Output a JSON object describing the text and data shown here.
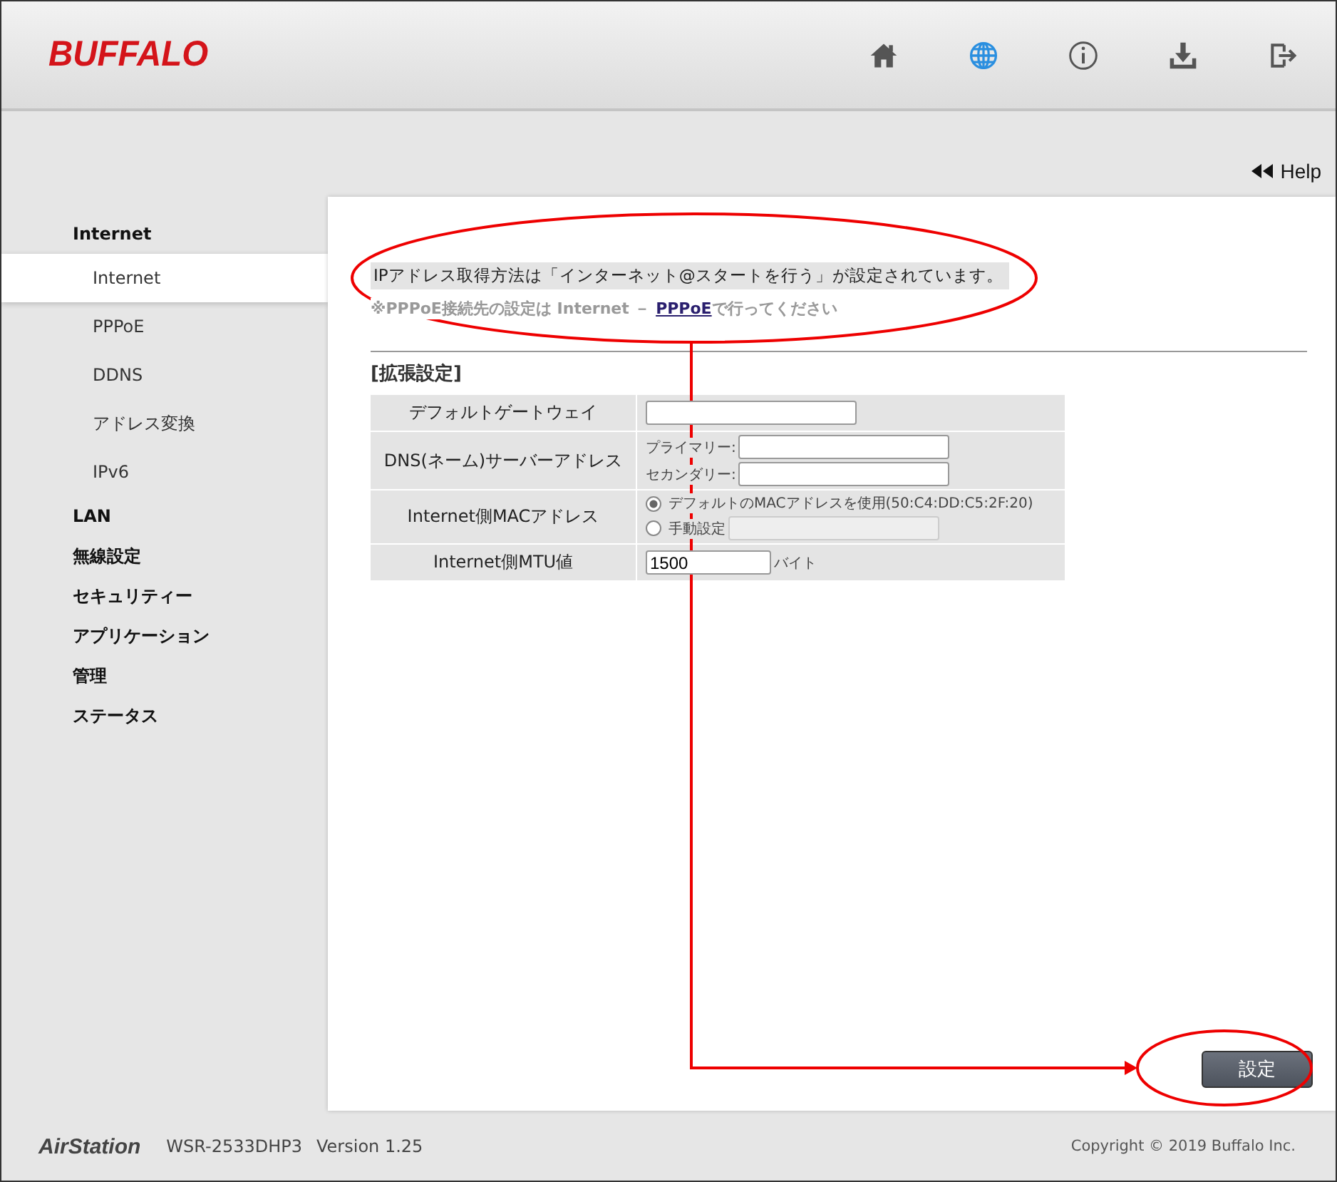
{
  "header": {
    "logo": "BUFFALO",
    "nav": [
      {
        "kind": "home",
        "selected": false
      },
      {
        "kind": "globe",
        "selected": true
      },
      {
        "kind": "info",
        "selected": false
      },
      {
        "kind": "download",
        "selected": false
      },
      {
        "kind": "logout",
        "selected": false
      }
    ]
  },
  "help": {
    "label": "Help"
  },
  "sidebar": {
    "items": [
      {
        "label": "Internet",
        "selected": false,
        "children": [
          {
            "label": "Internet",
            "selected": true
          },
          {
            "label": "PPPoE",
            "selected": false
          },
          {
            "label": "DDNS",
            "selected": false
          },
          {
            "label": "アドレス変換",
            "selected": false
          },
          {
            "label": "IPv6",
            "selected": false
          }
        ]
      },
      {
        "label": "LAN",
        "selected": false
      },
      {
        "label": "無線設定",
        "selected": false
      },
      {
        "label": "セキュリティー",
        "selected": false
      },
      {
        "label": "アプリケーション",
        "selected": false
      },
      {
        "label": "管理",
        "selected": false
      },
      {
        "label": "ステータス",
        "selected": false
      }
    ]
  },
  "content": {
    "info": "IPアドレス取得方法は「インターネット@スタートを行う」が設定されています。",
    "note": {
      "before": "※PPPoE接続先の設定は Internet － ",
      "link": "PPPoE",
      "after": "で行ってください"
    },
    "section_title": "[拡張設定]",
    "rows": [
      {
        "kind": "field",
        "label": "デフォルトゲートウェイ",
        "value": ""
      },
      {
        "kind": "dns",
        "label": "DNS(ネーム)サーバーアドレス",
        "primary_label": "プライマリー:",
        "secondary_label": "セカンダリー:"
      },
      {
        "kind": "mac",
        "label": "Internet側MACアドレス",
        "options": [
          {
            "label": "デフォルトのMACアドレスを使用(50:C4:DD:C5:2F:20)",
            "selected": true
          },
          {
            "label": "手動設定",
            "selected": false
          }
        ]
      },
      {
        "kind": "mtu",
        "label": "Internet側MTU値",
        "value": "1500",
        "unit": "バイト"
      }
    ],
    "button": "設定"
  },
  "footer": {
    "brand": "AirStation",
    "model": "WSR-2533DHP3",
    "version": "Version 1.25",
    "copyright": "Copyright © 2019 Buffalo Inc."
  }
}
